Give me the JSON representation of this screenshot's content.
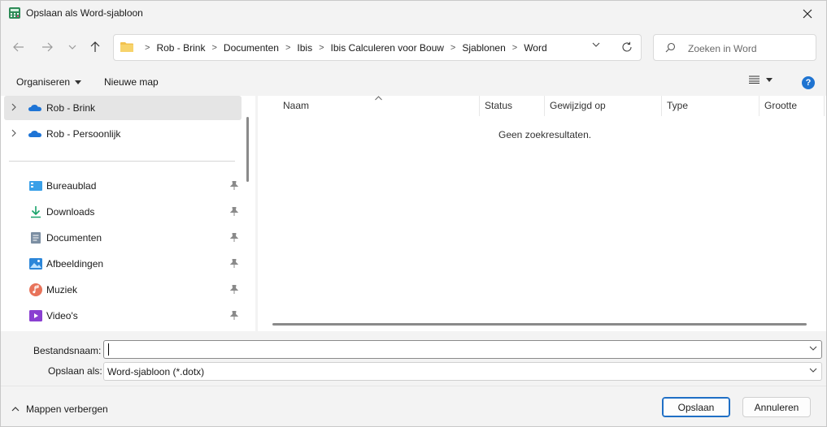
{
  "window": {
    "title": "Opslaan als Word-sjabloon"
  },
  "address": {
    "crumbs": [
      "Rob - Brink",
      "Documenten",
      "Ibis",
      "Ibis Calculeren voor Bouw",
      "Sjablonen",
      "Word"
    ]
  },
  "search": {
    "placeholder": "Zoeken in Word"
  },
  "commands": {
    "organize": "Organiseren",
    "new_folder": "Nieuwe map",
    "help": "?"
  },
  "nav": {
    "cloud": [
      "Rob - Brink",
      "Rob - Persoonlijk"
    ],
    "quick_access": [
      "Bureaublad",
      "Downloads",
      "Documenten",
      "Afbeeldingen",
      "Muziek",
      "Video's"
    ]
  },
  "files": {
    "columns": [
      "Naam",
      "Status",
      "Gewijzigd op",
      "Type",
      "Grootte"
    ],
    "empty_message": "Geen zoekresultaten."
  },
  "form": {
    "filename_label": "Bestandsnaam:",
    "filename_value": "",
    "filetype_label": "Opslaan als:",
    "filetype_value": "Word-sjabloon (*.dotx)"
  },
  "footer": {
    "toggle": "Mappen verbergen",
    "save": "Opslaan",
    "cancel": "Annuleren"
  },
  "colors": {
    "accent": "#1f6fc5",
    "folder": "#f2c14e",
    "onedrive": "#1e74d6"
  }
}
